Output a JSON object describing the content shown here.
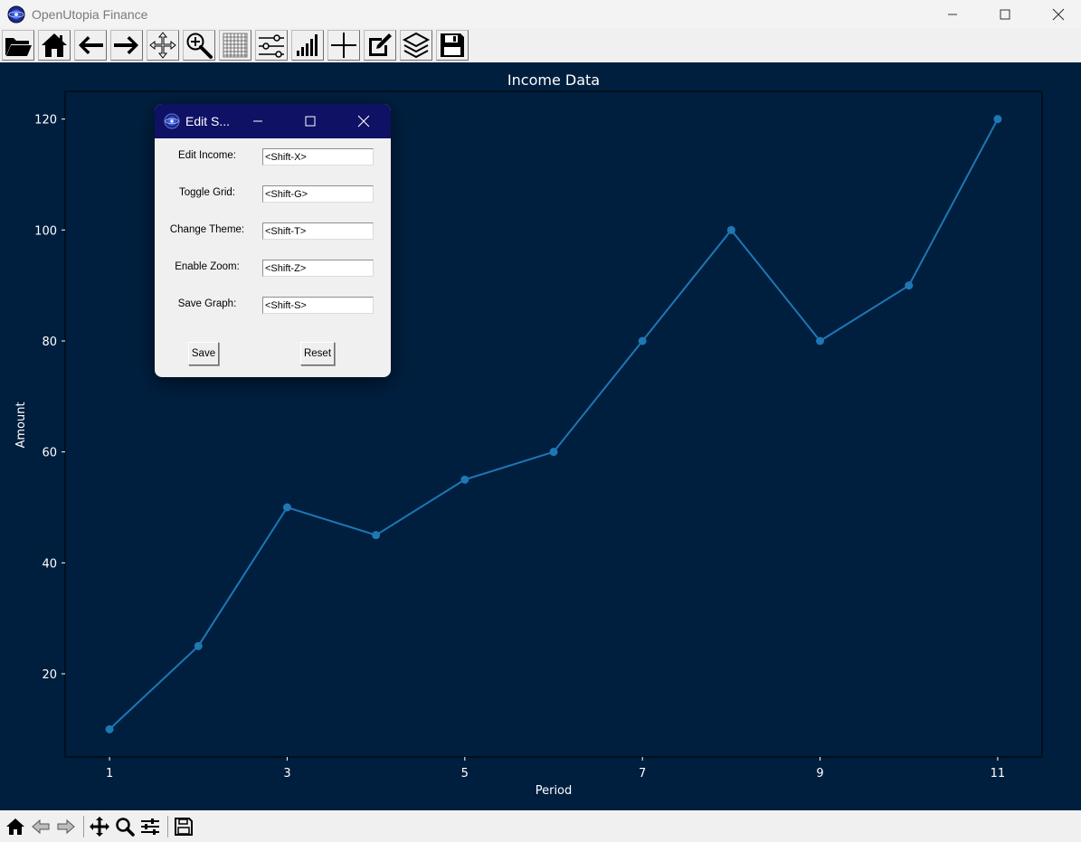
{
  "window": {
    "title": "OpenUtopia Finance",
    "app_icon": "globe-logo-icon",
    "controls": [
      "minimize-icon",
      "maximize-icon",
      "close-icon"
    ]
  },
  "toolbar": {
    "buttons": [
      {
        "name": "open-folder-icon"
      },
      {
        "name": "home-icon"
      },
      {
        "name": "back-arrow-icon"
      },
      {
        "name": "forward-arrow-icon"
      },
      {
        "name": "pan-move-icon"
      },
      {
        "name": "zoom-icon"
      },
      {
        "name": "grid-icon"
      },
      {
        "name": "settings-sliders-icon"
      },
      {
        "name": "bar-signal-icon"
      },
      {
        "name": "crosshair-plus-icon"
      },
      {
        "name": "edit-pencil-icon"
      },
      {
        "name": "layers-icon"
      },
      {
        "name": "save-floppy-icon"
      }
    ]
  },
  "chart_data": {
    "type": "line",
    "title": "Income Data",
    "xlabel": "Period",
    "ylabel": "Amount",
    "x": [
      1,
      2,
      3,
      4,
      5,
      6,
      7,
      8,
      9,
      10,
      11
    ],
    "series": [
      {
        "values": [
          10,
          25,
          50,
          45,
          55,
          60,
          80,
          100,
          80,
          90,
          120
        ]
      }
    ],
    "xticks": [
      1,
      3,
      5,
      7,
      9,
      11
    ],
    "yticks": [
      20,
      40,
      60,
      80,
      100,
      120
    ],
    "xlim": [
      0.5,
      11.5
    ],
    "ylim": [
      5,
      125
    ],
    "grid": false,
    "colors": {
      "background": "#001f3f",
      "line": "#1f77b4",
      "text": "#ffffff"
    }
  },
  "dialog": {
    "title": "Edit S...",
    "rows": [
      {
        "label": "Edit Income:",
        "value": "<Shift-X>"
      },
      {
        "label": "Toggle Grid:",
        "value": "<Shift-G>"
      },
      {
        "label": "Change Theme:",
        "value": "<Shift-T>"
      },
      {
        "label": "Enable Zoom:",
        "value": "<Shift-Z>"
      },
      {
        "label": "Save Graph:",
        "value": "<Shift-S>"
      }
    ],
    "save_label": "Save",
    "reset_label": "Reset",
    "title_color": "#0e1164"
  },
  "navbar": {
    "buttons": [
      "home-icon",
      "back-icon",
      "forward-icon",
      "pan-icon",
      "zoom-icon",
      "configure-subplots-icon",
      "save-icon"
    ]
  }
}
